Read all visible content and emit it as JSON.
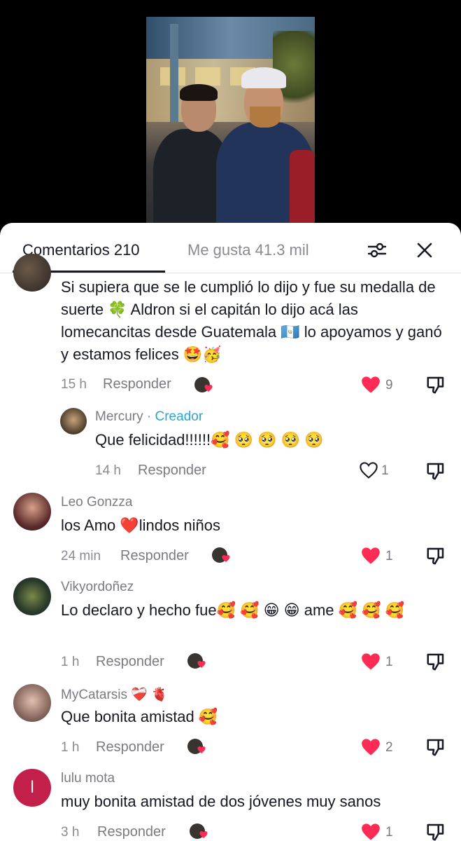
{
  "tabs": {
    "comments": "Comentarios 210",
    "likes": "Me gusta 41.3 mil"
  },
  "comments": [
    {
      "text": "Si supiera que se le cumplió lo dijo y fue su medalla de suerte 🍀 Aldron si el capitán lo dijo acá las lomecancitas desde Guatemala 🇬🇹 lo apoyamos y ganó y estamos felices 🤩🥳",
      "time": "15 h",
      "reply": "Responder",
      "likes": "9",
      "liked": true
    },
    {
      "user": "Mercury",
      "creator_label": "· Creador",
      "text": "Que felicidad!!!!!!🥰 🥺 🥺 🥺 🥺",
      "time": "14 h",
      "reply": "Responder",
      "likes": "1",
      "liked": false
    },
    {
      "user": "Leo Gonzza",
      "text": "los Amo ❤️lindos niños",
      "time": "24 min",
      "reply": "Responder",
      "likes": "1",
      "liked": true
    },
    {
      "user": "Vikyordoñez",
      "text": "Lo declaro y hecho fue🥰 🥰 😁 😁 ame 🥰 🥰 🥰",
      "time": "1 h",
      "reply": "Responder",
      "likes": "1",
      "liked": true
    },
    {
      "user": "MyCatarsis ❤️‍🩹 🫀",
      "text": "Que bonita amistad 🥰",
      "time": "1 h",
      "reply": "Responder",
      "likes": "2",
      "liked": true
    },
    {
      "user": "lulu mota",
      "avatar_letter": "l",
      "text": "muy bonita amistad de dos jóvenes muy sanos",
      "time": "3 h",
      "reply": "Responder",
      "likes": "1",
      "liked": true
    }
  ],
  "colors": {
    "heart_active": "#fe2c55",
    "creator": "#2aa7c8",
    "avatar_letter_bg": "#c21f4b"
  }
}
